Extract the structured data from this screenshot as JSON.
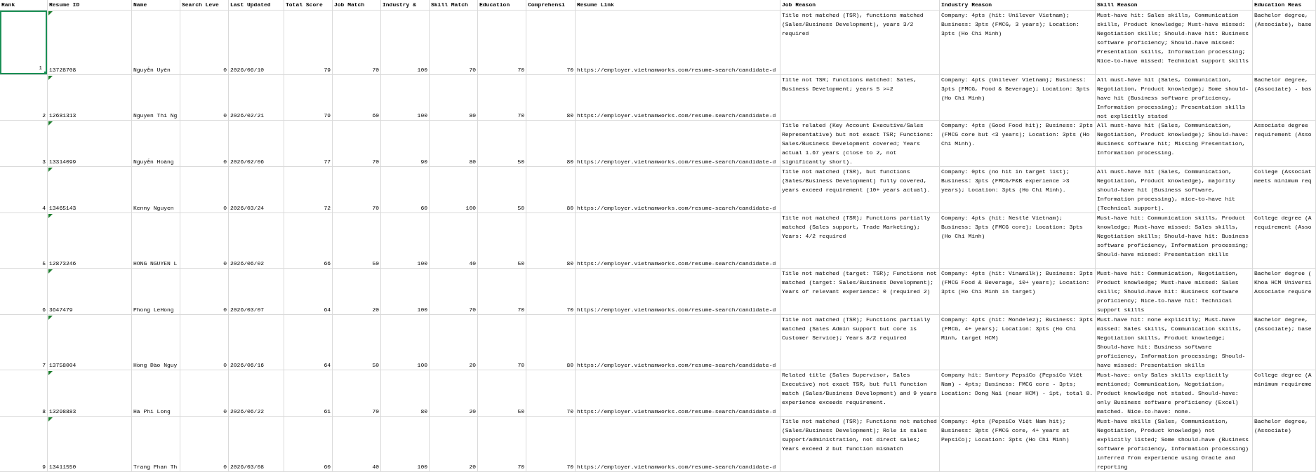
{
  "columns": [
    {
      "label": "Rank",
      "kind": "number"
    },
    {
      "label": "Resume ID",
      "kind": "text"
    },
    {
      "label": "Name",
      "kind": "text"
    },
    {
      "label": "Search Leve",
      "kind": "number"
    },
    {
      "label": "Last Updated",
      "kind": "text"
    },
    {
      "label": "Total Score",
      "kind": "number"
    },
    {
      "label": "Job Match",
      "kind": "number"
    },
    {
      "label": "Industry &",
      "kind": "number"
    },
    {
      "label": "Skill Match",
      "kind": "number"
    },
    {
      "label": "Education",
      "kind": "number"
    },
    {
      "label": "Comprehensi",
      "kind": "number"
    },
    {
      "label": "Resume Link",
      "kind": "text"
    },
    {
      "label": "Job Reason",
      "kind": "wrap"
    },
    {
      "label": "Industry Reason",
      "kind": "wrap"
    },
    {
      "label": "Skill Reason",
      "kind": "wrap"
    },
    {
      "label": "Education Reas",
      "kind": "wrap"
    }
  ],
  "rows": [
    {
      "selected": true,
      "flagged": true,
      "cells": [
        "1",
        "13728708",
        "Nguyễn Uyên",
        "0",
        "2026/06/10",
        "79",
        "70",
        "100",
        "70",
        "70",
        "70",
        "https://employer.vietnamworks.com/resume-search/candidate-d",
        "Title not matched (TSR), functions matched (Sales/Business Development), years 3/2 required",
        "Company: 4pts (hit: Unilever Vietnam); Business: 3pts (FMCG, 3 years); Location: 3pts (Ho Chi Minh)",
        "Must-have hit: Sales skills, Communication skills, Product knowledge; Must-have missed: Negotiation skills; Should-have hit: Business software proficiency; Should-have missed: Presentation skills, Information processing; Nice-to-have missed: Technical support skills",
        "Bachelor degree,\n(Associate), base"
      ]
    },
    {
      "selected": false,
      "flagged": true,
      "cells": [
        "2",
        "12681313",
        "Nguyen Thi Ng",
        "0",
        "2026/02/21",
        "79",
        "60",
        "100",
        "80",
        "70",
        "80",
        "https://employer.vietnamworks.com/resume-search/candidate-d",
        "Title not TSR; functions matched: Sales, Business Development; years 5 >=2",
        "Company: 4pts (Unilever Vietnam); Business: 3pts (FMCG, Food & Beverage); Location: 3pts (Ho Chi Minh)",
        "All must-have hit (Sales, Communication, Negotiation, Product knowledge); Some should-have hit (Business software proficiency, Information processing); Presentation skills not explicitly stated",
        "Bachelor degree,\n(Associate) - bas"
      ]
    },
    {
      "selected": false,
      "flagged": true,
      "cells": [
        "3",
        "13314099",
        "Nguyễn Hoàng",
        "0",
        "2026/02/06",
        "77",
        "70",
        "90",
        "80",
        "50",
        "80",
        "https://employer.vietnamworks.com/resume-search/candidate-d",
        "Title related (Key Account Executive/Sales Representative) but not exact TSR; Functions: Sales/Business Development covered; Years actual 1.67 years (close to 2, not significantly short).",
        "Company: 4pts (Good Food hit); Business: 2pts (FMCG core but <3 years); Location: 3pts (Ho Chi Minh).",
        "All must-have hit (Sales, Communication, Negotiation, Product knowledge); Should-have: Business software hit; Missing Presentation, Information processing.",
        "Associate degree\nrequirement (Asso"
      ]
    },
    {
      "selected": false,
      "flagged": true,
      "cells": [
        "4",
        "13465143",
        "Kenny Nguyen",
        "0",
        "2026/03/24",
        "72",
        "70",
        "60",
        "100",
        "50",
        "80",
        "https://employer.vietnamworks.com/resume-search/candidate-d",
        "Title not matched (TSR), but functions (Sales/Business Development) fully covered, years exceed requirement (10+ years actual).",
        "Company: 0pts (no hit in target list); Business: 3pts (FMCG/F&B experience >3 years); Location: 3pts (Ho Chi Minh).",
        "All must-have hit (Sales, Communication, Negotiation, Product knowledge), majority should-have hit (Business software, Information processing), nice-to-have hit (Technical support).",
        "College (Associat\nmeets minimum req"
      ]
    },
    {
      "selected": false,
      "flagged": true,
      "cells": [
        "5",
        "12873246",
        "HONG NGUYEN L",
        "0",
        "2026/06/02",
        "66",
        "50",
        "100",
        "40",
        "50",
        "80",
        "https://employer.vietnamworks.com/resume-search/candidate-d",
        "Title not matched (TSR); Functions partially matched (Sales support, Trade Marketing); Years: 4/2 required",
        "Company: 4pts (hit: Nestlé Vietnam); Business: 3pts (FMCG core); Location: 3pts (Ho Chi Minh)",
        "Must-have hit: Communication skills, Product knowledge; Must-have missed: Sales skills, Negotiation skills; Should-have hit: Business software proficiency, Information processing; Should-have missed: Presentation skills",
        "College degree (A\nrequirement (Asso"
      ]
    },
    {
      "selected": false,
      "flagged": true,
      "cells": [
        "6",
        "3647479",
        "Phong LeHong",
        "0",
        "2026/03/07",
        "64",
        "20",
        "100",
        "70",
        "70",
        "70",
        "https://employer.vietnamworks.com/resume-search/candidate-d",
        "Title not matched (target: TSR); Functions not matched (target: Sales/Business Development); Years of relevant experience: 0 (required 2)",
        "Company: 4pts (hit: Vinamilk); Business: 3pts (FMCG Food & Beverage, 10+ years); Location: 3pts (Ho Chi Minh in target)",
        "Must-have hit: Communication, Negotiation, Product knowledge; Must-have missed: Sales skills; Should-have hit: Business software proficiency; Nice-to-have hit: Technical support skills",
        "Bachelor degree (\nKhoa HCM Universi\nAssociate require"
      ]
    },
    {
      "selected": false,
      "flagged": true,
      "cells": [
        "7",
        "13758004",
        "Hồng Đào Nguy",
        "0",
        "2026/06/16",
        "64",
        "50",
        "100",
        "20",
        "70",
        "80",
        "https://employer.vietnamworks.com/resume-search/candidate-d",
        "Title not matched (TSR); Functions partially matched (Sales Admin support but core is Customer Service); Years 8/2 required",
        "Company: 4pts (hit: Mondelez); Business: 3pts (FMCG, 4+ years); Location: 3pts (Ho Chi Minh, target HCM)",
        "Must-have hit: none explicitly; Must-have missed: Sales skills, Communication skills, Negotiation skills, Product knowledge; Should-have hit: Business software proficiency, Information processing; Should-have missed: Presentation skills",
        "Bachelor degree,\n(Associate); base"
      ]
    },
    {
      "selected": false,
      "flagged": true,
      "cells": [
        "8",
        "13298883",
        "Hà Phi Long",
        "0",
        "2026/06/22",
        "61",
        "70",
        "80",
        "20",
        "50",
        "70",
        "https://employer.vietnamworks.com/resume-search/candidate-d",
        "Related title (Sales Supervisor, Sales Executive) not exact TSR, but full function match (Sales/Business Development) and 9 years experience exceeds requirement.",
        "Company hit: Suntory PepsiCo (PepsiCo Việt Nam) - 4pts; Business: FMCG core - 3pts; Location: Dong Nai (near HCM) - 1pt, total 8.",
        "Must-have: only Sales skills explicitly mentioned; Communication, Negotiation, Product knowledge not stated. Should-have: only Business software proficiency (Excel) matched. Nice-to-have: none.",
        "College degree (A\nminimum requireme"
      ]
    },
    {
      "selected": false,
      "flagged": true,
      "cells": [
        "9",
        "13411550",
        "Trang Phan Th",
        "0",
        "2026/03/08",
        "60",
        "40",
        "100",
        "20",
        "70",
        "70",
        "https://employer.vietnamworks.com/resume-search/candidate-d",
        "Title not matched (TSR); Functions not matched (Sales/Business Development); Role is sales support/administration, not direct sales; Years exceed 2 but function mismatch",
        "Company: 4pts (PepsiCo Việt Nam hit); Business: 3pts (FMCG core, 4+ years at PepsiCo); Location: 3pts (Ho Chi Minh)",
        "Must-have skills (Sales, Communication, Negotiation, Product knowledge) not explicitly listed; Some should-have (Business software proficiency, Information processing) inferred from experience using Oracle and reporting",
        "Bachelor degree,\n(Associate)"
      ]
    }
  ]
}
